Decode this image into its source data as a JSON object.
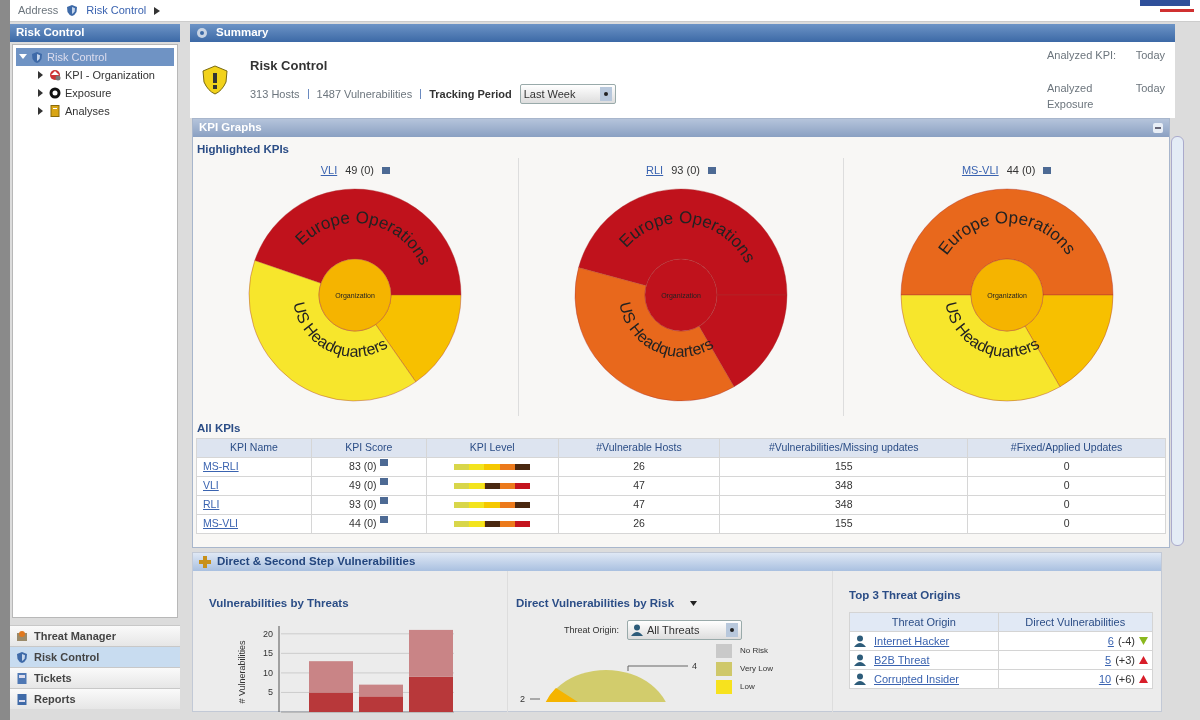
{
  "address_bar": {
    "label": "Address",
    "path": "Risk Control"
  },
  "sidebar": {
    "title": "Risk Control",
    "tree": [
      {
        "label": "Risk Control",
        "selected": true,
        "expanded": true,
        "children": [
          {
            "label": "KPI - Organization",
            "selected": false,
            "expanded": false
          },
          {
            "label": "Exposure",
            "selected": false,
            "expanded": false
          },
          {
            "label": "Analyses",
            "selected": false,
            "expanded": false
          }
        ]
      }
    ],
    "nav": [
      {
        "label": "Threat Manager",
        "selected": false
      },
      {
        "label": "Risk Control",
        "selected": true
      },
      {
        "label": "Tickets",
        "selected": false
      },
      {
        "label": "Reports",
        "selected": false
      }
    ]
  },
  "summary": {
    "title": "Summary",
    "heading": "Risk Control",
    "hosts": "313 Hosts",
    "vulnerabilities": "1487 Vulnerabilities",
    "tracking_label": "Tracking Period",
    "tracking_value": "Last Week",
    "analyzed": [
      {
        "label": "Analyzed KPI:",
        "value": "Today"
      },
      {
        "label": "Analyzed Exposure",
        "value": "Today"
      }
    ]
  },
  "kpi_graphs": {
    "title": "KPI Graphs",
    "highlighted_title": "Highlighted KPIs",
    "sunbursts": [
      {
        "name": "VLI",
        "score": "49 (0)",
        "center": {
          "label": "Organization",
          "color": "#f5b400"
        },
        "segments": [
          {
            "label": "Europe Operations",
            "color": "#c0121c"
          },
          {
            "color": "#f7c000"
          },
          {
            "label": "US Headquarters",
            "color": "#f7e62c"
          }
        ]
      },
      {
        "name": "RLI",
        "score": "93 (0)",
        "center": {
          "label": "Organization",
          "color": "#c0121c"
        },
        "segments": [
          {
            "label": "Europe Operations",
            "color": "#c0121c"
          },
          {
            "color": "#c0121c"
          },
          {
            "label": "US Headquarters",
            "color": "#e8681c"
          }
        ]
      },
      {
        "name": "MS-VLI",
        "score": "44 (0)",
        "center": {
          "label": "Organization",
          "color": "#f5b400"
        },
        "segments": [
          {
            "label": "Europe Operations",
            "color": "#e8681c"
          },
          {
            "color": "#f7c000"
          },
          {
            "label": "US Headquarters",
            "color": "#f7e62c"
          }
        ]
      }
    ],
    "all_title": "All KPIs",
    "table": {
      "columns": [
        "KPI Name",
        "KPI Score",
        "KPI Level",
        "#Vulnerable Hosts",
        "#Vulnerabilities/Missing updates",
        "#Fixed/Applied Updates"
      ],
      "rows": [
        {
          "name": "MS-RLI",
          "score": "83 (0)",
          "level": 0.9,
          "hosts": "26",
          "vulnerabilities": "155",
          "fixed": "0"
        },
        {
          "name": "VLI",
          "score": "49 (0)",
          "level": 0.5,
          "hosts": "47",
          "vulnerabilities": "348",
          "fixed": "0"
        },
        {
          "name": "RLI",
          "score": "93 (0)",
          "level": 0.9,
          "hosts": "47",
          "vulnerabilities": "348",
          "fixed": "0"
        },
        {
          "name": "MS-VLI",
          "score": "44 (0)",
          "level": 0.5,
          "hosts": "26",
          "vulnerabilities": "155",
          "fixed": "0"
        }
      ]
    }
  },
  "vulnerabilities": {
    "title": "Direct & Second Step Vulnerabilities",
    "by_threats": {
      "title": "Vulnerabilities by Threats",
      "chart_data": {
        "type": "bar",
        "ylabel": "# Vulnerabilities",
        "stacked": true,
        "grid": true,
        "yticks": [
          5,
          10,
          15,
          20
        ],
        "ylim": [
          0,
          22
        ],
        "series": [
          {
            "color": "#b8383a",
            "values": [
              5,
              4,
              9
            ]
          },
          {
            "color": "#c98486",
            "values": [
              8,
              3,
              12
            ]
          }
        ]
      }
    },
    "by_risk": {
      "title": "Direct Vulnerabilities by Risk",
      "filter_label": "Threat Origin:",
      "filter_value": "All Threats",
      "data_labels": [
        "4",
        "2"
      ],
      "legend": [
        {
          "label": "No Risk",
          "color": "#c9c9c9"
        },
        {
          "label": "Very Low",
          "color": "#cfc86a"
        },
        {
          "label": "Low",
          "color": "#f7e21e"
        }
      ]
    },
    "top_origins": {
      "title": "Top 3 Threat Origins",
      "columns": [
        "Threat Origin",
        "Direct Vulnerabilities"
      ],
      "rows": [
        {
          "origin": "Internet Hacker",
          "count": "6",
          "change": "(-4)",
          "kind": "decrease"
        },
        {
          "origin": "B2B Threat",
          "count": "5",
          "change": "(+3)",
          "kind": "increase"
        },
        {
          "origin": "Corrupted Insider",
          "count": "10",
          "change": "(+6)",
          "kind": "increase"
        }
      ]
    }
  }
}
